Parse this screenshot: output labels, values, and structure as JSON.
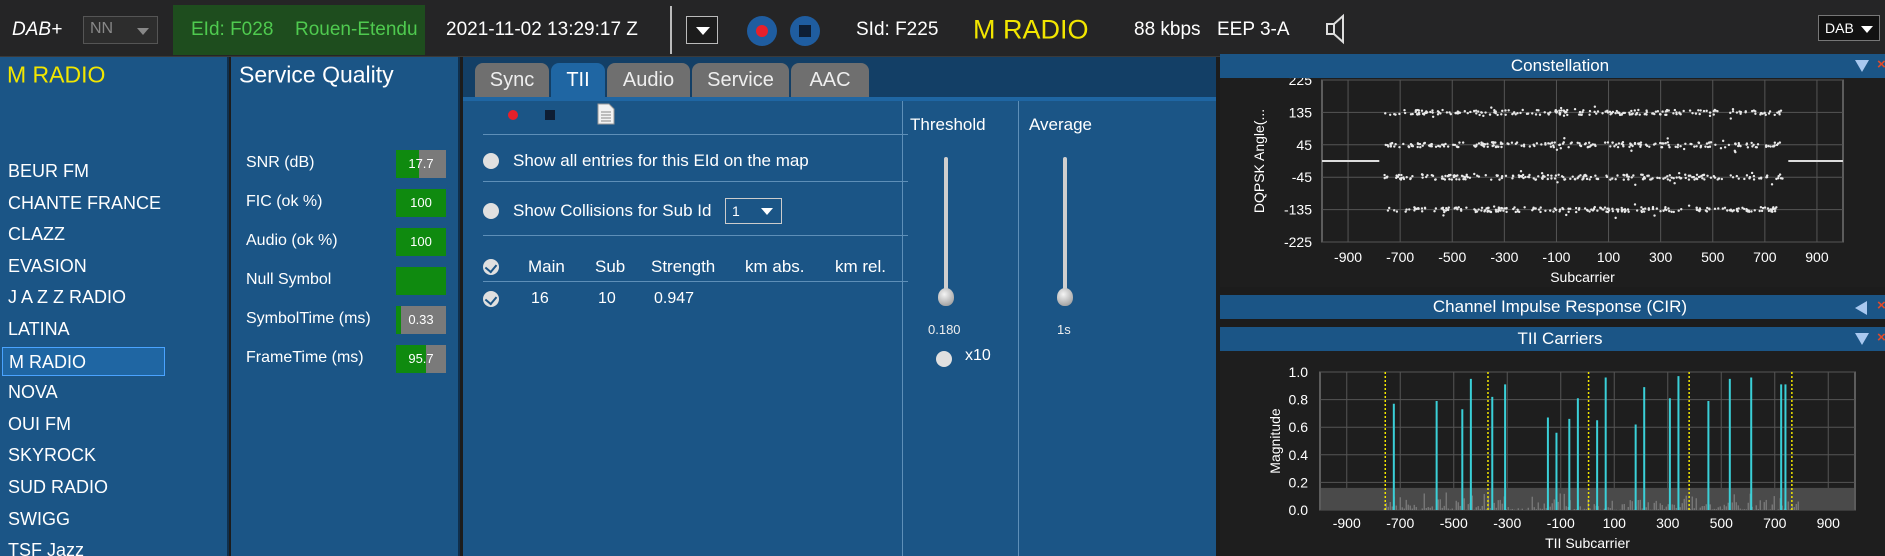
{
  "topbar": {
    "mode_label": "DAB+",
    "nn_select": "NN",
    "eid": "EId: F028",
    "ensemble": "Rouen-Etendu",
    "datetime": "2021-11-02  13:29:17 Z",
    "sid": "SId: F225",
    "service": "M RADIO",
    "bitrate": "88 kbps",
    "protection": "EEP 3-A",
    "band_select": "DAB"
  },
  "stations": {
    "title": "M RADIO",
    "items": [
      "BEUR FM",
      "CHANTE FRANCE",
      "CLAZZ",
      "EVASION",
      "J A Z Z RADIO",
      "LATINA",
      "M RADIO",
      "NOVA",
      "OUI FM",
      "SKYROCK",
      "SUD RADIO",
      "SWIGG",
      "TSF Jazz"
    ],
    "selected": "M RADIO"
  },
  "quality": {
    "title": "Service Quality",
    "rows": [
      {
        "label": "SNR (dB)",
        "value": "17.7",
        "fill": 0.45
      },
      {
        "label": "FIC (ok %)",
        "value": "100",
        "fill": 1.0
      },
      {
        "label": "Audio (ok %)",
        "value": "100",
        "fill": 1.0
      },
      {
        "label": "Null Symbol",
        "value": "",
        "fill": 1.0
      },
      {
        "label": "SymbolTime (ms)",
        "value": "0.33",
        "fill": 0.1
      },
      {
        "label": "FrameTime (ms)",
        "value": "95.7",
        "fill": 0.6
      }
    ]
  },
  "tabs": [
    "Sync",
    "TII",
    "Audio",
    "Service",
    "AAC"
  ],
  "active_tab": "TII",
  "tii": {
    "option_map": "Show all entries for this EId on the map",
    "option_collisions": "Show Collisions for Sub Id",
    "sub_id_select": "1",
    "columns": [
      "Main",
      "Sub",
      "Strength",
      "km abs.",
      "km rel."
    ],
    "rows": [
      {
        "main": "16",
        "sub": "10",
        "strength": "0.947",
        "km_abs": "",
        "km_rel": ""
      }
    ],
    "threshold_label": "Threshold",
    "threshold_value": "0.180",
    "threshold_level": 0.18,
    "x10_label": "x10",
    "average_label": "Average",
    "average_value": "1s",
    "average_level": 0.0
  },
  "constellation": {
    "title": "Constellation",
    "ylabel": "DQPSK  Angle(...",
    "xlabel": "Subcarrier",
    "yticks": [
      "225",
      "135",
      "45",
      "-45",
      "-135",
      "-225"
    ],
    "xticks": [
      "-900",
      "-700",
      "-500",
      "-300",
      "-100",
      "100",
      "300",
      "500",
      "700",
      "900"
    ]
  },
  "cir": {
    "title": "Channel Impulse Response (CIR)"
  },
  "tii_carriers": {
    "title": "TII Carriers",
    "ylabel": "Magnitude",
    "xlabel": "TII Subcarrier",
    "yticks": [
      "1.0",
      "0.8",
      "0.6",
      "0.4",
      "0.2",
      "0.0"
    ],
    "xticks": [
      "-900",
      "-700",
      "-500",
      "-300",
      "-100",
      "100",
      "300",
      "500",
      "700",
      "900"
    ]
  },
  "chart_data": [
    {
      "type": "scatter",
      "title": "Constellation",
      "xlabel": "Subcarrier",
      "ylabel": "DQPSK  Angle(...",
      "xlim": [
        -1000,
        1000
      ],
      "ylim": [
        -225,
        225
      ],
      "series": [
        {
          "x": [
            -760,
            770
          ],
          "y": [
            135,
            135
          ]
        },
        {
          "x": [
            -760,
            770
          ],
          "y": [
            45,
            45
          ]
        },
        {
          "x": [
            -760,
            770
          ],
          "y": [
            -45,
            -45
          ]
        },
        {
          "x": [
            -760,
            770
          ],
          "y": [
            -135,
            -135
          ]
        }
      ],
      "reference_line_y": 0,
      "grid": true
    },
    {
      "type": "bar",
      "title": "TII Carriers",
      "xlabel": "TII Subcarrier",
      "ylabel": "Magnitude",
      "xlim": [
        -1000,
        1000
      ],
      "ylim": [
        0,
        1.0
      ],
      "x": [
        -724,
        -564,
        -468,
        -436,
        -356,
        -308,
        -148,
        -116,
        -68,
        -36,
        36,
        68,
        180,
        212,
        308,
        340,
        452,
        532,
        612,
        724,
        740
      ],
      "values": [
        0.77,
        0.79,
        0.73,
        0.95,
        0.82,
        0.91,
        0.67,
        0.56,
        0.66,
        0.81,
        0.65,
        0.96,
        0.62,
        0.89,
        0.81,
        0.97,
        0.79,
        0.95,
        0.96,
        0.91,
        0.91
      ],
      "marker_lines_x": [
        -756,
        -372,
        4,
        380,
        764
      ],
      "grid": true
    }
  ]
}
